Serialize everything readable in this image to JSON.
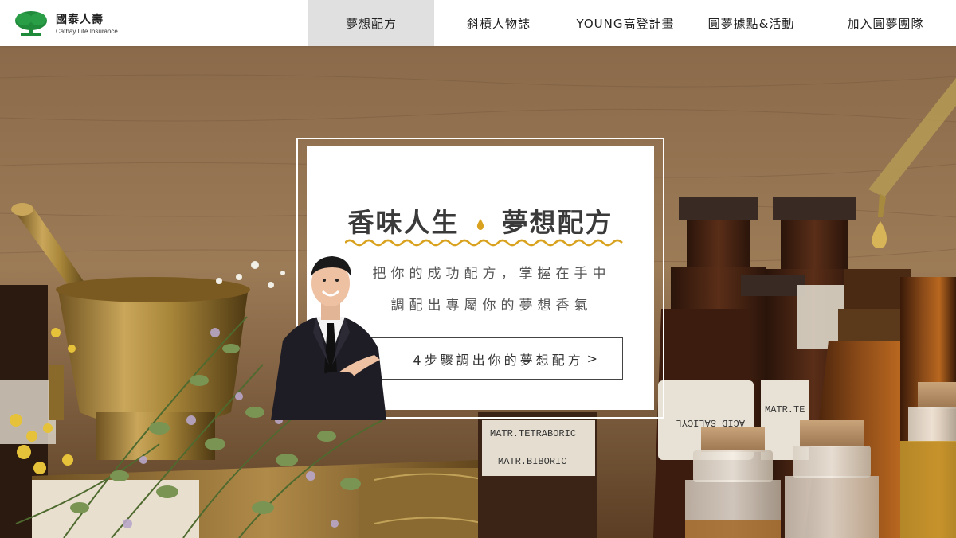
{
  "header": {
    "logo_cn": "國泰人壽",
    "logo_en": "Cathay Life Insurance",
    "nav": [
      {
        "label": "夢想配方",
        "active": true
      },
      {
        "label": "斜槓人物誌",
        "active": false
      },
      {
        "label": "YOUNG高登計畫",
        "active": false
      },
      {
        "label": "圓夢據點&活動",
        "active": false
      },
      {
        "label": "加入圓夢團隊",
        "active": false
      }
    ]
  },
  "hero": {
    "title_left": "香味人生",
    "title_right": "夢想配方",
    "subtitle_1": "把你的成功配方，掌握在手中",
    "subtitle_2": "調配出專屬你的夢想香氣",
    "cta_label": "4步驟調出你的夢想配方",
    "cta_arrow": ">",
    "bottle_labels": [
      "MATR.TETRABORIC",
      "MATR.BIBORIC",
      "ACID SALICYL",
      "MATR.TE"
    ],
    "colors": {
      "accent": "#d9a21e",
      "brand_green": "#1f8a3a"
    }
  }
}
